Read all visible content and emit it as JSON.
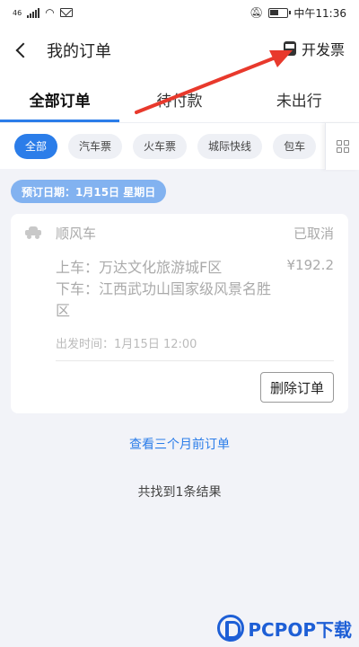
{
  "status_bar": {
    "signal_label": "⁴⁶",
    "carrier": "中午",
    "time": "中午11:36"
  },
  "header": {
    "title": "我的订单",
    "invoice_label": "开发票"
  },
  "tabs": [
    {
      "label": "全部订单",
      "active": true
    },
    {
      "label": "待付款",
      "active": false
    },
    {
      "label": "未出行",
      "active": false
    }
  ],
  "filters": [
    {
      "label": "全部",
      "active": true
    },
    {
      "label": "汽车票",
      "active": false
    },
    {
      "label": "火车票",
      "active": false
    },
    {
      "label": "城际快线",
      "active": false
    },
    {
      "label": "包车",
      "active": false
    }
  ],
  "date_pill": "预订日期：1月15日 星期日",
  "order": {
    "type": "顺风车",
    "status": "已取消",
    "pickup": "上车：万达文化旅游城F区",
    "dropoff": "下车：江西武功山国家级风景名胜区",
    "price": "¥192.2",
    "depart_time": "出发时间：1月15日 12:00",
    "delete_label": "删除订单"
  },
  "footer": {
    "view_older": "查看三个月前订单",
    "result_count": "共找到1条结果"
  },
  "watermark": {
    "brand": "PCPOP下载"
  },
  "colors": {
    "accent": "#2b7de9",
    "date_pill": "#82b2f0",
    "annotation_arrow": "#e8392c"
  }
}
